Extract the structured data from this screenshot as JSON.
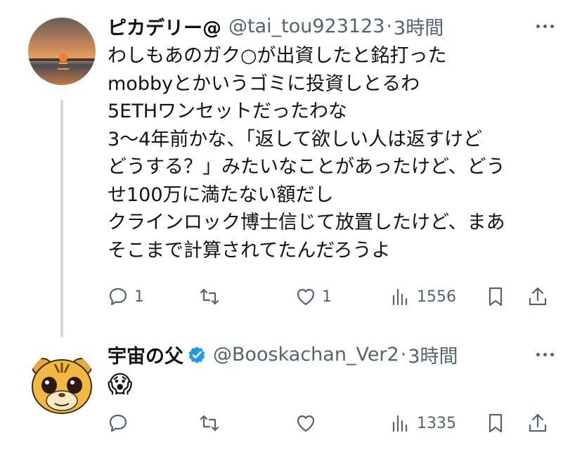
{
  "tweets": [
    {
      "name": "ピカデリー@",
      "handle": "@tai_tou923123",
      "dot": "·",
      "time": "3時間",
      "lines": [
        "わしもあのガク○が出資したと銘打った",
        "mobbyとかいうゴミに投資しとるわ",
        "5ETHワンセットだったわな",
        "3〜4年前かな、「返して欲しい人は返すけど",
        "どうする？」みたいなことがあったけど、どう",
        "せ100万に満たない額だし",
        "クラインロック博士信じて放置したけど、まあ",
        "そこまで計算されてたんだろうよ"
      ],
      "replies": "1",
      "retweets": "",
      "likes": "1",
      "views": "1556"
    },
    {
      "name": "宇宙の父",
      "handle": "@Booskachan_Ver2",
      "dot": "·",
      "time": "3時間",
      "emoji": "😱",
      "replies": "",
      "retweets": "",
      "likes": "",
      "views": "1335"
    }
  ],
  "icons": [
    "reply-icon",
    "retweet-icon",
    "like-icon",
    "views-icon",
    "bookmark-icon",
    "share-icon",
    "more-icon",
    "verified-icon"
  ],
  "colors": {
    "text": "#0f1419",
    "secondary": "#536471",
    "verified": "#1d9bf0",
    "thread_line": "#cfd9de"
  }
}
